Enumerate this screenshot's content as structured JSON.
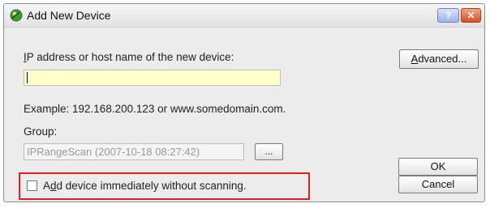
{
  "window": {
    "title": "Add New Device",
    "help_button": "?",
    "close_button": "✕"
  },
  "form": {
    "ip_label_first": "I",
    "ip_label_rest": "P address or host name of the new device:",
    "ip_value": "",
    "example_text": "Example: 192.168.200.123 or www.somedomain.com.",
    "group_label": "Group:",
    "group_value": "IPRangeScan (2007-10-18 08:27:42)",
    "browse_button": "...",
    "checkbox_before": "A",
    "checkbox_underlined": "d",
    "checkbox_after": "d device immediately without scanning.",
    "checkbox_checked": false
  },
  "buttons": {
    "advanced_first": "A",
    "advanced_rest": "dvanced...",
    "ok": "OK",
    "cancel": "Cancel"
  },
  "colors": {
    "input_background": "#ffffcc",
    "highlight_border": "#dd1e1e"
  }
}
